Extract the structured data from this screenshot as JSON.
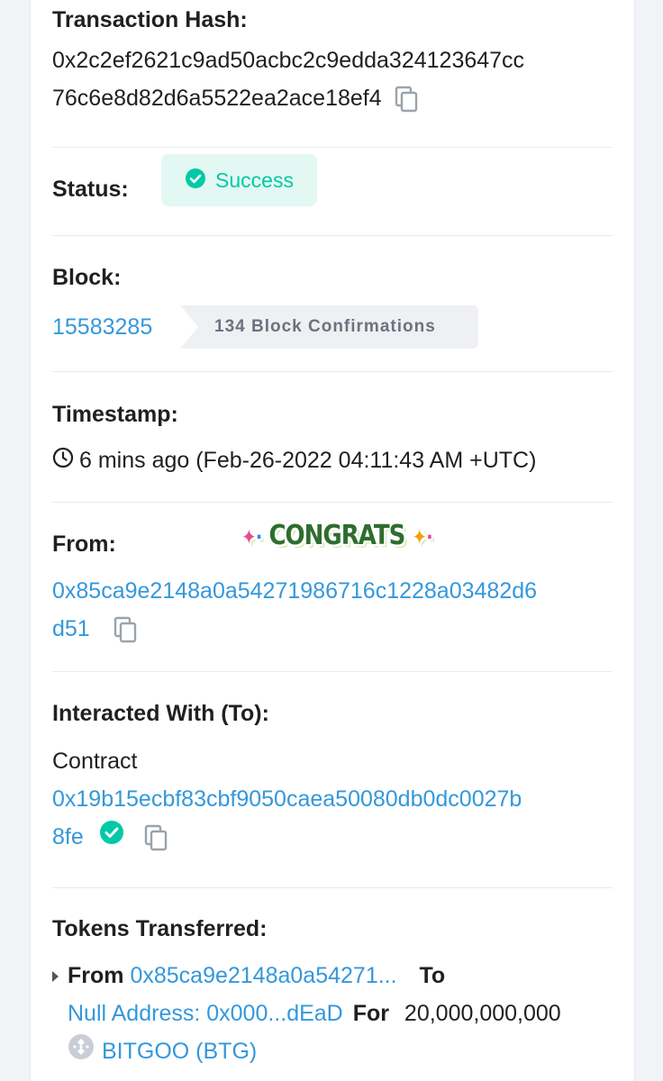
{
  "tx_hash": {
    "label": "Transaction Hash:",
    "line1": "0x2c2ef2621c9ad50acbc2c9edda324123647cc",
    "line2": "76c6e8d82d6a5522ea2ace18ef4"
  },
  "status": {
    "label": "Status:",
    "value": "Success",
    "color": "#00c9a7"
  },
  "block": {
    "label": "Block:",
    "number": "15583285",
    "confirmations": "134 Block Confirmations"
  },
  "timestamp": {
    "label": "Timestamp:",
    "value": "6 mins ago (Feb-26-2022 04:11:43 AM +UTC)"
  },
  "from": {
    "label": "From:",
    "line1": "0x85ca9e2148a0a54271986716c1228a03482d6",
    "line2": "d51",
    "sticker": "CONGRATS"
  },
  "to": {
    "label": "Interacted With (To):",
    "prefix": "Contract",
    "line1": "0x19b15ecbf83cbf9050caea50080db0dc0027b",
    "line2": "8fe"
  },
  "tokens": {
    "label": "Tokens Transferred:",
    "from_label": "From",
    "from_address": "0x85ca9e2148a0a54271...",
    "to_label": "To",
    "to_address": "Null Address: 0x000...dEaD",
    "for_label": "For",
    "amount": "20,000,000,000",
    "token_name": "BITGOO (BTG)"
  },
  "colors": {
    "link": "#3498db",
    "success": "#00c9a7",
    "divider": "#e7eaf3"
  }
}
